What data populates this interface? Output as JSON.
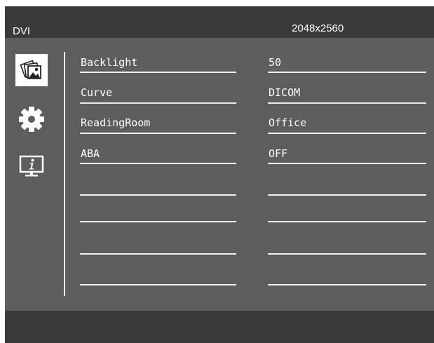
{
  "header": {
    "source": "DVI",
    "resolution": "2048x2560"
  },
  "sidebar": {
    "items": [
      {
        "icon": "image-settings-icon",
        "selected": true
      },
      {
        "icon": "gear-icon",
        "selected": false
      },
      {
        "icon": "info-icon",
        "selected": false
      }
    ]
  },
  "menu": {
    "rows": [
      {
        "label": "Backlight",
        "value": "50"
      },
      {
        "label": "Curve",
        "value": "DICOM"
      },
      {
        "label": "ReadingRoom",
        "value": "Office"
      },
      {
        "label": "ABA",
        "value": "OFF"
      },
      {
        "label": "",
        "value": ""
      },
      {
        "label": "",
        "value": ""
      },
      {
        "label": "",
        "value": ""
      },
      {
        "label": "",
        "value": ""
      }
    ]
  },
  "colors": {
    "panel": "#5d5d5d",
    "bars": "#3a3a3a",
    "text": "#ffffff",
    "lines": "#f0f0f0"
  }
}
